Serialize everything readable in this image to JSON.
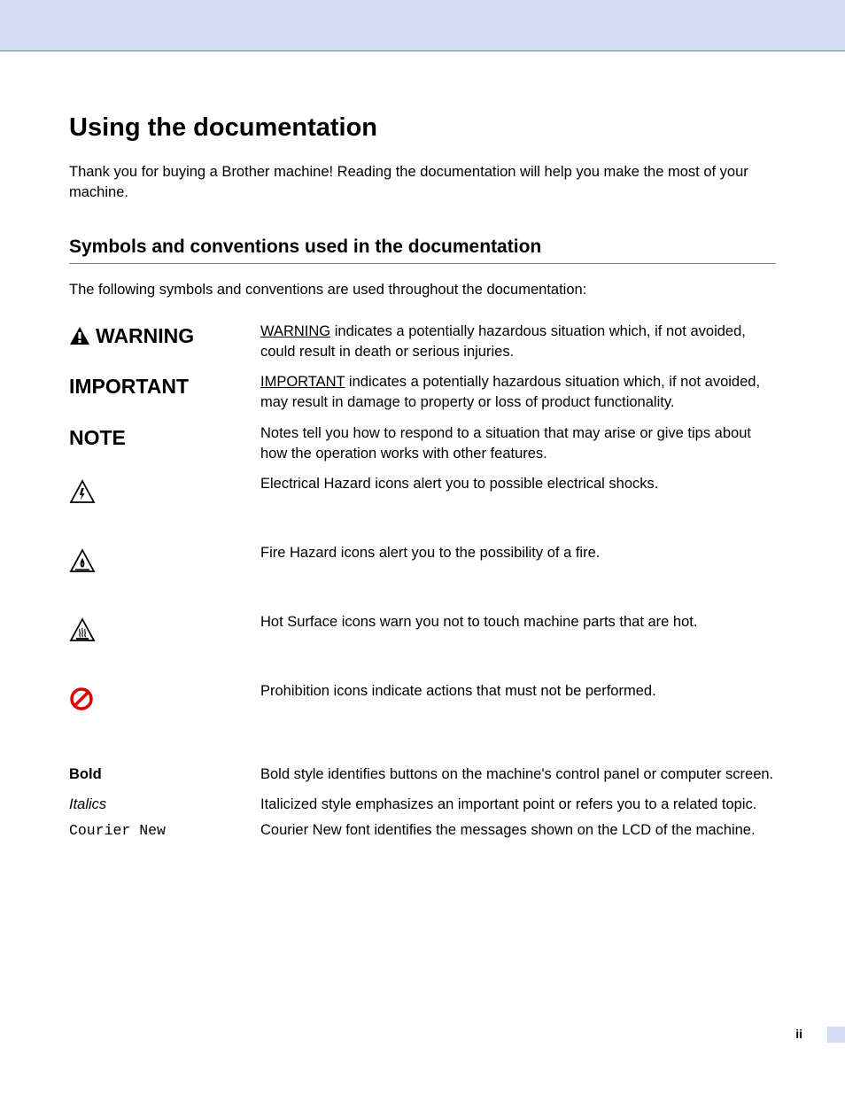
{
  "main_title": "Using the documentation",
  "intro_text": "Thank you for buying a Brother machine! Reading the documentation will help you make the most of your machine.",
  "section_title": "Symbols and conventions used in the documentation",
  "section_intro": "The following symbols and conventions are used throughout the documentation:",
  "rows": {
    "warning": {
      "label": "WARNING",
      "desc_underline": "WARNING",
      "desc_rest": " indicates a potentially hazardous situation which, if not avoided, could result in death or serious injuries."
    },
    "important": {
      "label": "IMPORTANT",
      "desc_underline": "IMPORTANT",
      "desc_rest": " indicates a potentially hazardous situation which, if not avoided, may result in damage to property or loss of product functionality."
    },
    "note": {
      "label": "NOTE",
      "desc": "Notes tell you how to respond to a situation that may arise or give tips about how the operation works with other features."
    },
    "electrical": {
      "desc": "Electrical Hazard icons alert you to possible electrical shocks."
    },
    "fire": {
      "desc": "Fire Hazard icons alert you to the possibility of a fire."
    },
    "hot": {
      "desc": "Hot Surface icons warn you not to touch machine parts that are hot."
    },
    "prohibition": {
      "desc": "Prohibition icons indicate actions that must not be performed."
    },
    "bold": {
      "label": "Bold",
      "desc": "Bold style identifies buttons on the machine's control panel or computer screen."
    },
    "italics": {
      "label": "Italics",
      "desc": "Italicized style emphasizes an important point or refers you to a related topic."
    },
    "courier": {
      "label": "Courier New",
      "desc": "Courier New font identifies the messages shown on the LCD of the machine."
    }
  },
  "page_number": "ii"
}
